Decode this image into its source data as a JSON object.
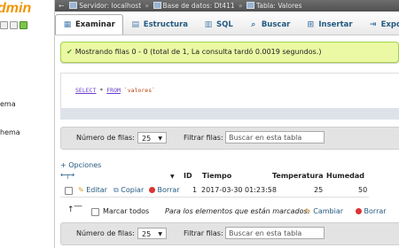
{
  "sidebar": {
    "logo_text": "dmin",
    "tree": [
      "ema",
      "hema"
    ]
  },
  "breadcrumb": {
    "server": "Servidor: localhost",
    "database": "Base de datos: Dt411",
    "table": "Tabla: Valores"
  },
  "tabs": [
    {
      "label": "Examinar",
      "icon": "grid-icon"
    },
    {
      "label": "Estructura",
      "icon": "structure-icon"
    },
    {
      "label": "SQL",
      "icon": "sql-icon"
    },
    {
      "label": "Buscar",
      "icon": "search-icon"
    },
    {
      "label": "Insertar",
      "icon": "insert-icon"
    },
    {
      "label": "Exportar",
      "icon": "export-icon"
    }
  ],
  "message": "Mostrando filas 0 - 0 (total de 1, La consulta tardó 0.0019 segundos.)",
  "sql": {
    "kw1": "SELECT",
    "star": "*",
    "kw2": "FROM",
    "table": "`valores`"
  },
  "nav": {
    "rows_label": "Número de filas:",
    "rows_value": "25",
    "filter_label": "Filtrar filas:",
    "filter_placeholder": "Buscar en esta tabla"
  },
  "options_link": "+ Opciones",
  "table": {
    "columns": [
      "ID",
      "Tiempo",
      "Temperatura",
      "Humedad"
    ],
    "row": {
      "edit": "Editar",
      "copy": "Copiar",
      "delete": "Borrar",
      "id": "1",
      "tiempo": "2017-03-30 01:23:58",
      "temperatura": "25",
      "humedad": "50"
    }
  },
  "marked": {
    "check_all": "Marcar todos",
    "for_marked": "Para los elementos que están marcados:",
    "change": "Cambiar",
    "delete": "Borrar"
  }
}
